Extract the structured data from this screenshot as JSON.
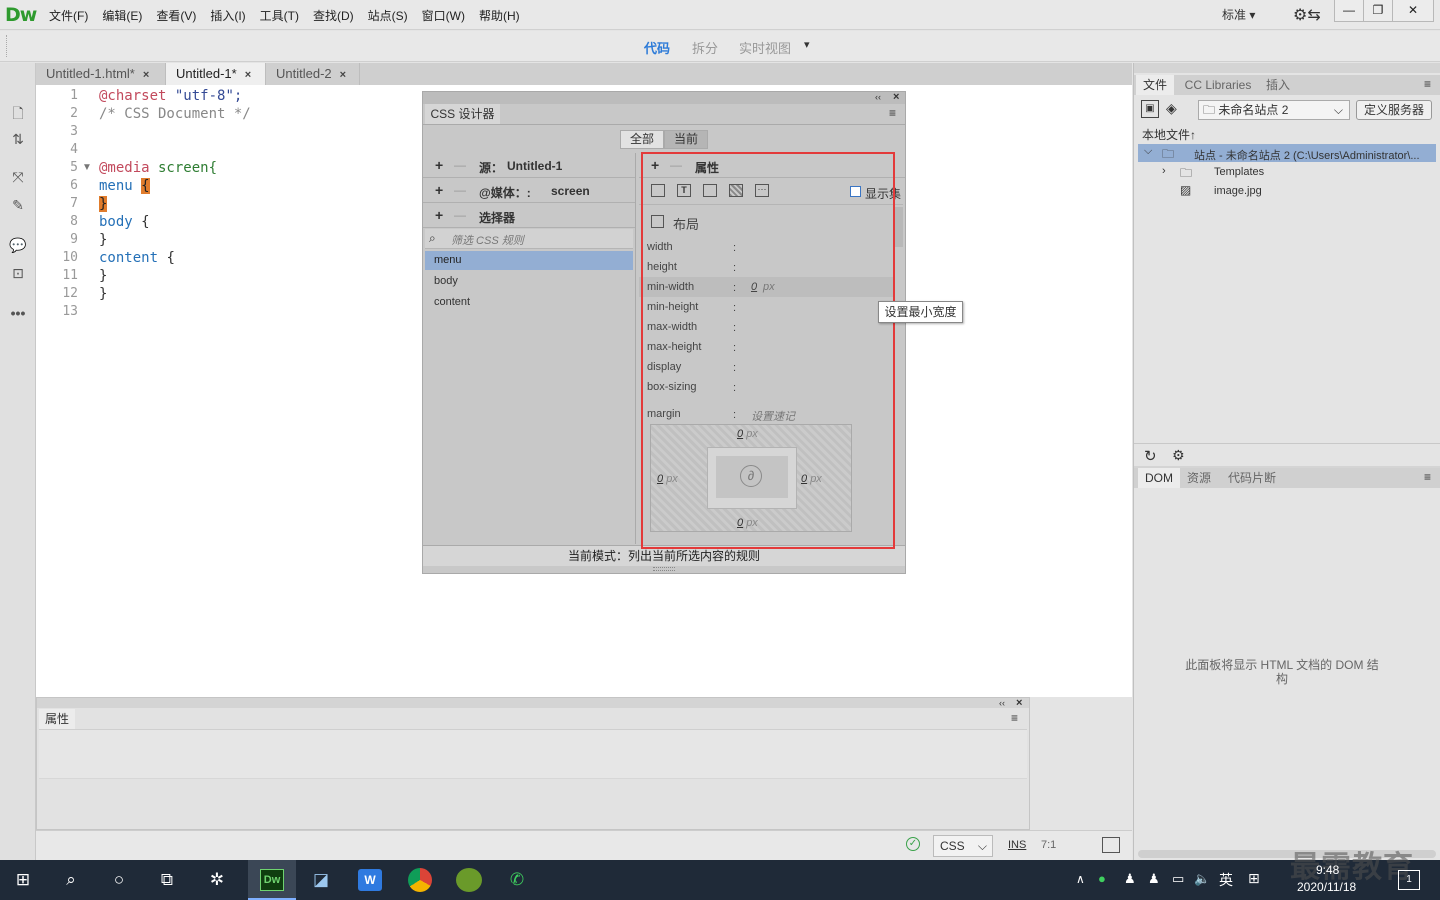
{
  "app": {
    "logo": "Dw",
    "menus": [
      "文件(F)",
      "编辑(E)",
      "查看(V)",
      "插入(I)",
      "工具(T)",
      "查找(D)",
      "站点(S)",
      "窗口(W)",
      "帮助(H)"
    ],
    "workspace": "标准",
    "workspace_arrow": "▾"
  },
  "window_buttons": {
    "minimize": "—",
    "restore": "❐",
    "close": "✕"
  },
  "viewbar": {
    "code": "代码",
    "split": "拆分",
    "live": "实时视图",
    "arrow": "▾"
  },
  "tabs": [
    {
      "label": "Untitled-1.html*",
      "close": "×"
    },
    {
      "label": "Untitled-1*",
      "close": "×"
    },
    {
      "label": "Untitled-2",
      "close": "×"
    }
  ],
  "code_lines": [
    "1",
    "2",
    "3",
    "4",
    "5",
    "6",
    "7",
    "8",
    "9",
    "10",
    "11",
    "12",
    "13"
  ],
  "code": {
    "l1a": "@charset",
    "l1b": " \"utf-8\";",
    "l2": "/* CSS Document */",
    "fold": "▼",
    "l5a": "@media",
    "l5b": " screen{",
    "l6a": "menu",
    "l6b": "{",
    "l7": "}",
    "l8a": "body",
    "l8b": " {",
    "l9": "}",
    "l10a": "content",
    "l10b": " {",
    "l11": "}",
    "l12": "}"
  },
  "css_designer": {
    "title": "CSS 设计器",
    "collapse": "‹‹",
    "close": "×",
    "menu": "≡",
    "all": "全部",
    "current": "当前",
    "plus": "+",
    "minus": "—",
    "sources_label": "源：",
    "sources_value": "Untitled-1",
    "media_label": "@媒体：:",
    "media_value": "screen",
    "selectors_label": "选择器",
    "filter_placeholder": "筛选 CSS 规则",
    "selectors": [
      "menu",
      "body",
      "content"
    ],
    "properties_label": "属性",
    "show_set": "显示集",
    "layout_label": "布局",
    "props": [
      "width",
      "height",
      "min-width",
      "min-height",
      "max-width",
      "max-height",
      "display",
      "box-sizing"
    ],
    "colon": ":",
    "minwidth_value": "0",
    "minwidth_unit": "px",
    "tooltip": "设置最小宽度",
    "margin_label": "margin",
    "margin_hint": "设置速记",
    "margin_top": "0",
    "margin_bottom": "0",
    "margin_left": "0",
    "margin_right": "0",
    "margin_unit": "px",
    "link_icon": "∂",
    "status": "当前模式：列出当前所选内容的规则"
  },
  "properties_panel": {
    "title": "属性",
    "collapse": "‹‹",
    "close": "×",
    "menu": "≡"
  },
  "status_bar": {
    "lang": "CSS",
    "lang_arrow": "⌵",
    "ins": "INS",
    "pos": "7:1",
    "ok": "✓"
  },
  "right_panel": {
    "tabs": [
      "文件",
      "CC Libraries",
      "插入"
    ],
    "site": "未命名站点 2",
    "site_arrow": "⌵",
    "define_server": "定义服务器",
    "local_files": "本地文件",
    "sort": "↑",
    "tree_root": "站点 - 未命名站点 2 (C:\\Users\\Administrator\\...",
    "tree_items": [
      "Templates",
      "image.jpg"
    ],
    "bottom_tabs": [
      "DOM",
      "资源",
      "代码片断"
    ],
    "dom_message": "此面板将显示 HTML 文档的 DOM 结构",
    "menu": "≡"
  },
  "taskbar": {
    "time": "9:48",
    "date": "2020/11/18",
    "lang": "英",
    "watermark": "最需教育",
    "notif": "1",
    "up_arrow": "∧",
    "volume": "🔈"
  },
  "colors": {
    "accent_green": "#2e9a2e",
    "selection": "#93aed3",
    "highlight_red": "#e33a3a",
    "taskbar": "#1f2a38"
  }
}
